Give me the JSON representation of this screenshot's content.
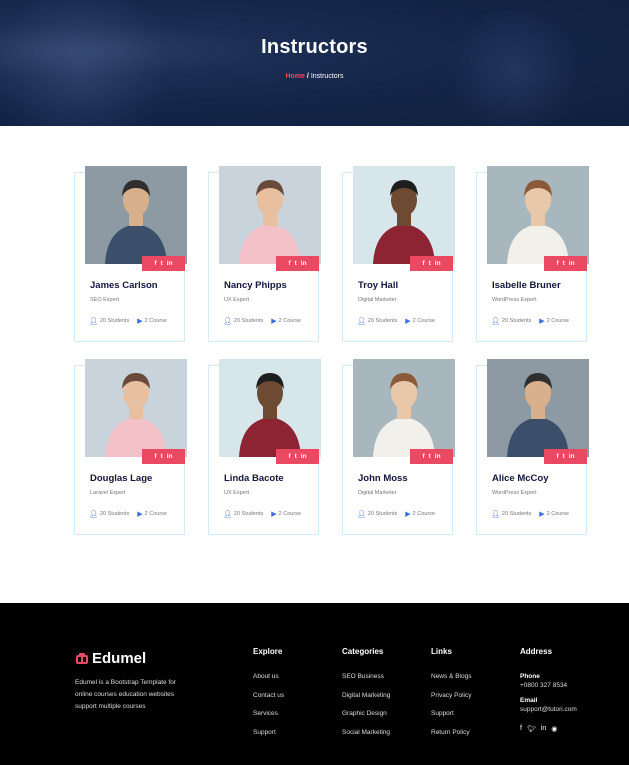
{
  "hero": {
    "title": "Instructors",
    "breadcrumb_home": "Home",
    "breadcrumb_sep": "/",
    "breadcrumb_current": "Instructors"
  },
  "instructors": [
    {
      "name": "James Carlson",
      "role": "SEO Expert",
      "students": "20 Students",
      "courses": "2 Course"
    },
    {
      "name": "Nancy Phipps",
      "role": "UX Expert",
      "students": "20 Students",
      "courses": "2 Course"
    },
    {
      "name": "Troy Hall",
      "role": "Digital Marketer",
      "students": "20 Students",
      "courses": "2 Course"
    },
    {
      "name": "Isabelle Bruner",
      "role": "WordPress Expert",
      "students": "20 Students",
      "courses": "2 Course"
    },
    {
      "name": "Douglas Lage",
      "role": "Laravel Expert",
      "students": "20 Students",
      "courses": "2 Course"
    },
    {
      "name": "Linda Bacote",
      "role": "UX Expert",
      "students": "20 Students",
      "courses": "2 Course"
    },
    {
      "name": "John Moss",
      "role": "Digital Marketer",
      "students": "20 Students",
      "courses": "2 Course"
    },
    {
      "name": "Alice McCoy",
      "role": "WordPress Expert",
      "students": "20 Students",
      "courses": "2 Course"
    }
  ],
  "social_icons": [
    "f",
    "t",
    "in"
  ],
  "footer": {
    "logo": "Edumel",
    "description": "Edumel is a Bootstrap Template for online courses education websites support multiple courses",
    "explore": {
      "title": "Explore",
      "links": [
        "About us",
        "Contact us",
        "Services",
        "Support"
      ]
    },
    "categories": {
      "title": "Categories",
      "links": [
        "SEO Business",
        "Digital Marketing",
        "Graphic Design",
        "Social Marketing"
      ]
    },
    "links": {
      "title": "Links",
      "links": [
        "News & Blogs",
        "Privacy Policy",
        "Support",
        "Return Policy"
      ]
    },
    "address": {
      "title": "Address",
      "phone_label": "Phone",
      "phone": "+0800 327 8534",
      "email_label": "Email",
      "email": "support@tutori.com"
    }
  },
  "colors": {
    "accent": "#e94a62",
    "hero_bg": "#132548",
    "card_border": "#d6ebf7",
    "icon_blue": "#3a6fd8"
  }
}
